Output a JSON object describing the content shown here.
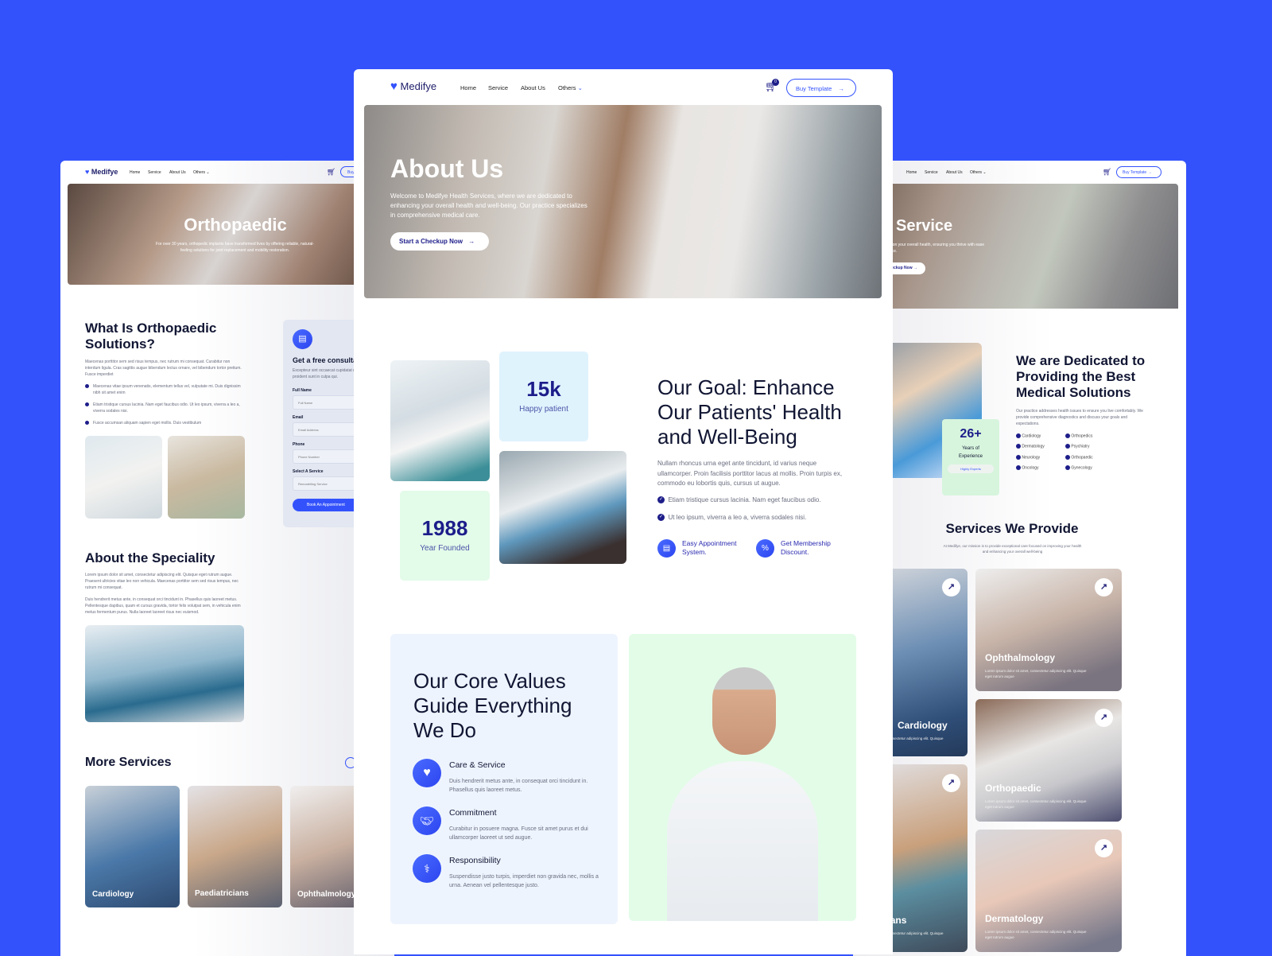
{
  "brand": "Medifye",
  "nav": {
    "home": "Home",
    "service": "Service",
    "about": "About Us",
    "others": "Others",
    "cart_count": "0",
    "buy": "Buy Template"
  },
  "colors": {
    "background": "#3352fc",
    "accent": "#3352fc",
    "navy": "#1d1d8a",
    "stat_blue": "#dff3fd",
    "stat_green": "#e3fbe9",
    "values_bg": "#eef4fe"
  },
  "left": {
    "hero_title": "Orthopaedic",
    "hero_text": "For over 30 years, orthopedic implants have transformed lives by offering reliable, natural-feeling solutions for joint replacement and mobility restoration.",
    "what_title": "What Is Orthopaedic Solutions?",
    "what_text": "Maecenas porttitor sem sed risus tempus, nec rutrum mi consequat. Curabitur non interdum ligula. Cras sagittis augue bibendum lectus ornare, vel bibendum tortor pretium. Fusce imperdiet",
    "bullets": [
      "Maecenas vitae ipsum venenatis, elementum tellus vel, vulputate mi. Duis dignissim nibh sit amet enim",
      "Etiam tristique cursus lacinia. Nam eget faucibus odio. Ut leo ipsum, viverra a leo a, viverra sodales nisi.",
      "Fusce accumsan aliquam sapien eget mollis. Duis vestibulum"
    ],
    "form": {
      "title": "Get a free consultation",
      "text": "Excepteur sint occaecat cupidatat non proident sunt in culpa qui.",
      "full_name_label": "Full Name",
      "full_name_ph": "Full Name",
      "email_label": "Email",
      "email_ph": "Email Address",
      "phone_label": "Phone",
      "phone_ph": "Phone Number",
      "service_label": "Select A Service",
      "service_value": "Remodelling Service",
      "submit": "Book An Appointment"
    },
    "about_title": "About the Speciality",
    "about_p1": "Lorem ipsum dolor sit amet, consectetur adipiscing elit. Quisque eget rutrum augue. Praesent ultricies vitae leo non vehicula. Maecenas porttitor sem sed risus tempus, nec rutrum mi consequat.",
    "about_p2": "Duis hendrerit metus ante, in consequat orci tincidunt in. Phasellus quis laoreet metus. Pellentesque dapibus, quam et cursus gravida, tortor felis volutpat sem, in vehicula enim metus fermentum purus. Nulla laoreet laoreet risus nec euismod.",
    "more_title": "More Services",
    "more_cards": [
      "Cardiology",
      "Paediatricians",
      "Ophthalmology"
    ]
  },
  "center": {
    "hero_title": "About Us",
    "hero_text": "Welcome to Medifye Health Services, where we are dedicated to enhancing your overall health and well-being. Our practice specializes in comprehensive medical care.",
    "hero_button": "Start a Checkup Now",
    "stat1_value": "15k",
    "stat1_label": "Happy patient",
    "stat2_value": "1988",
    "stat2_label": "Year Founded",
    "goal_title": "Our Goal: Enhance Our Patients' Health and Well-Being",
    "goal_text": "Nullam rhoncus urna eget ante tincidunt, id varius neque ullamcorper. Proin facilisis porttitor lacus at mollis. Proin turpis ex, commodo eu lobortis quis, cursus ut augue.",
    "goal_checks": [
      "Etiam tristique cursus lacinia. Nam eget faucibus odio.",
      "Ut leo ipsum, viverra a leo a, viverra sodales nisi."
    ],
    "feature1": "Easy Appointment System.",
    "feature2": "Get Membership Discount.",
    "values_title": "Our Core Values Guide Everything We Do",
    "values": [
      {
        "title": "Care & Service",
        "text": "Duis hendrerit metus ante, in consequat orci tincidunt in. Phasellus quis laoreet metus."
      },
      {
        "title": "Commitment",
        "text": "Curabitur in posuere magna. Fusce sit amet purus et dui ullamcorper laoreet ut sed augue."
      },
      {
        "title": "Responsibility",
        "text": "Suspendisse justo turpis, imperdiet non gravida nec, mollis a urna. Aenean vel pellentesque justo."
      }
    ]
  },
  "right": {
    "hero_title": "Service",
    "hero_text": "care focuses on your overall health, ensuring you thrive with ease and confidence.",
    "hero_button": "Start a Checkup Now",
    "stat_value": "26+",
    "stat_label": "Years of Experience",
    "stat_badge": "Highly Experts",
    "dedicated_title": "We are Dedicated to Providing the Best Medical Solutions",
    "dedicated_text": "Our practice addresses health issues to ensure you live comfortably. We provide comprehensive diagnostics and discuss your goals and expectations.",
    "list": [
      "Cardiology",
      "Orthopedics",
      "Dermatology",
      "Psychiatry",
      "Neurology",
      "Orthopaedic",
      "Oncology",
      "Gynecology"
    ],
    "services_title": "Services We Provide",
    "services_text": "At Medifye, our mission is to provide exceptional care focused on improving your health and enhancing your overall well-being",
    "card_text": "Lorem ipsum dolor sit amet, consectetur adipiscing elit. Quisque eget rutrum augue",
    "cards": [
      "Cardiology",
      "Ophthalmology",
      "Orthopaedic",
      "Paediatricians",
      "Dermatology"
    ]
  }
}
